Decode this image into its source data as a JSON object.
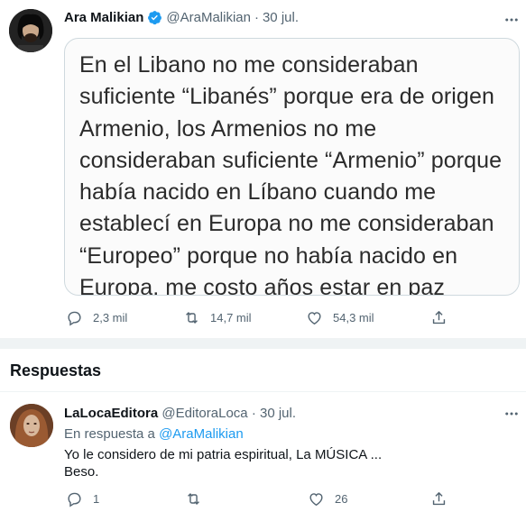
{
  "tweet": {
    "author_name": "Ara Malikian",
    "handle": "@AraMalikian",
    "separator": "·",
    "date": "30 jul.",
    "image_text": "En el Libano no me consideraban suficiente “Libanés” porque era de origen Armenio, los Armenios no me consideraban suficiente “Armenio” porque había nacido en Líbano cuando me establecí en Europa no me consideraban “Europeo” porque no había nacido en Europa, me costo años estar en paz",
    "replies": "2,3 mil",
    "retweets": "14,7 mil",
    "likes": "54,3 mil"
  },
  "section": {
    "title": "Respuestas"
  },
  "reply": {
    "author_name": "LaLocaEditora",
    "handle": "@EditoraLoca",
    "separator": "·",
    "date": "30 jul.",
    "in_reply_prefix": "En respuesta a",
    "in_reply_handle": "@AraMalikian",
    "text_line1": "Yo le considero de mi patria espiritual, La MÚSICA ...",
    "text_line2": "Beso.",
    "replies": "1",
    "likes": "26"
  },
  "colors": {
    "accent": "#1d9bf0",
    "secondary_text": "#536471",
    "divider": "#eff3f4"
  }
}
